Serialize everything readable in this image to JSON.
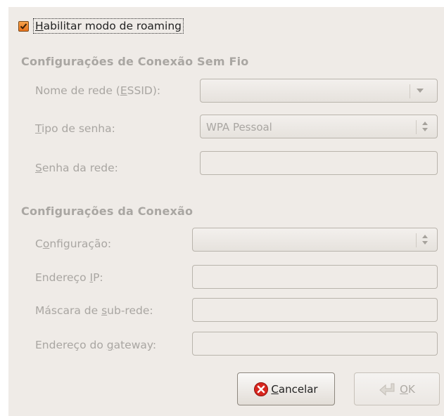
{
  "roaming": {
    "label": "Habilitar modo de roaming",
    "mnemonic": "H",
    "rest": "abilitar modo de roaming",
    "checked": true
  },
  "wireless": {
    "title": "Configurações de Conexão Sem Fio",
    "essid_label_pre": "Nome de rede (",
    "essid_label_mn": "E",
    "essid_label_post": "SSID):",
    "essid_value": "",
    "password_type_label_mn": "T",
    "password_type_label_rest": "ipo de senha:",
    "password_type_value": "WPA Pessoal",
    "password_label_mn": "S",
    "password_label_rest": "enha da rede:",
    "password_value": ""
  },
  "connection": {
    "title": "Configurações da Conexão",
    "config_label_pre": "C",
    "config_label_mn": "o",
    "config_label_post": "nfiguração:",
    "config_value": "",
    "ip_label_pre": "Endereço ",
    "ip_label_mn": "I",
    "ip_label_post": "P:",
    "ip_value": "",
    "mask_label_pre": "Máscara de ",
    "mask_label_mn": "s",
    "mask_label_post": "ub-rede:",
    "mask_value": "",
    "gateway_label_pre": "Endereço do ",
    "gateway_label_mn": "g",
    "gateway_label_post": "ateway:",
    "gateway_value": ""
  },
  "buttons": {
    "cancel_mn": "C",
    "cancel_rest": "ancelar",
    "ok_mn": "O",
    "ok_rest": "K"
  },
  "colors": {
    "check_orange": "#e7721b",
    "cancel_red": "#d8261e",
    "label_disabled": "#a9a6a2"
  }
}
